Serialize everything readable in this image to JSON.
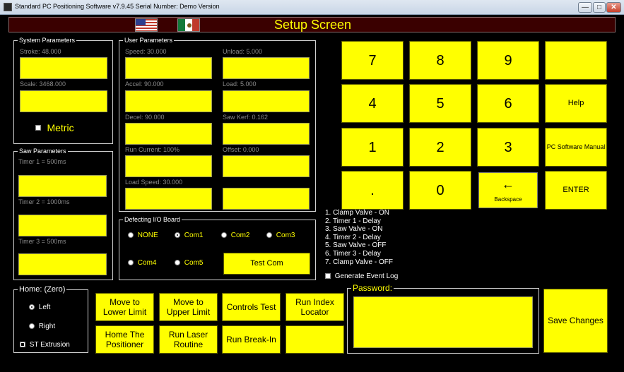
{
  "window": {
    "title": "Standard PC Positioning Software v7.9.45    Serial Number: Demo Version",
    "minimize": "—",
    "maximize": "□",
    "close": "✕"
  },
  "header": {
    "title": "Setup Screen",
    "flags": [
      "flag-us",
      "flag-mexico"
    ]
  },
  "system_params": {
    "legend": "System Parameters",
    "stroke_label": "Stroke: 48.000",
    "scale_label": "Scale: 3468.000",
    "metric_label": "Metric",
    "metric_checked": false
  },
  "saw_params": {
    "legend": "Saw Parameters",
    "timer1_label": "Timer 1 = 500ms",
    "timer2_label": "Timer 2 = 1000ms",
    "timer3_label": "Timer 3 = 500ms"
  },
  "user_params": {
    "legend": "User Parameters",
    "speed_label": "Speed: 30.000",
    "unload_label": "Unload: 5.000",
    "accel_label": "Accel: 90.000",
    "load_label": "Load: 5.000",
    "decel_label": "Decel: 90.000",
    "saw_kerf_label": "Saw Kerf: 0.162",
    "run_current_label": "Run Current: 100%",
    "offset_label": "Offset: 0.000",
    "load_speed_label": "Load Speed: 30.000"
  },
  "io_board": {
    "legend": "Defecting I/O Board",
    "none": "NONE",
    "com1": "Com1",
    "com2": "Com2",
    "com3": "Com3",
    "com4": "Com4",
    "com5": "Com5",
    "selected": "Com1",
    "test_com": "Test Com"
  },
  "keypad": {
    "k7": "7",
    "k8": "8",
    "k9": "9",
    "k4": "4",
    "k5": "5",
    "k6": "6",
    "k1": "1",
    "k2": "2",
    "k3": "3",
    "dot": ".",
    "k0": "0",
    "help": "Help",
    "manual": "PC Software Manual",
    "backspace_arrow": "←",
    "backspace": "Backspace",
    "enter": "ENTER"
  },
  "sequence": {
    "items": [
      "1. Clamp Valve - ON",
      "2. Timer 1 - Delay",
      "3. Saw Valve - ON",
      "4. Timer 2 - Delay",
      "5. Saw Valve - OFF",
      "6. Timer 3 - Delay",
      "7. Clamp Valve - OFF"
    ],
    "event_log_label": "Generate Event Log",
    "event_log_checked": false
  },
  "home": {
    "legend": "Home:  (Zero)",
    "left": "Left",
    "right": "Right",
    "st_extrusion": "ST Extrusion",
    "selected": "Left",
    "st_checked": true
  },
  "actions": {
    "move_lower": "Move to\nLower Limit",
    "move_upper": "Move to\nUpper Limit",
    "controls_test": "Controls Test",
    "run_index": "Run Index\nLocator",
    "home_positioner": "Home The\nPositioner",
    "run_laser": "Run Laser\nRoutine",
    "run_breakin": "Run Break-In",
    "blank": ""
  },
  "password": {
    "legend": "Password:",
    "value": ""
  },
  "save": "Save Changes",
  "colors": {
    "background": "#000000",
    "button": "#ffff00",
    "header_bg": "#3a0000",
    "header_text": "#ffff00"
  }
}
